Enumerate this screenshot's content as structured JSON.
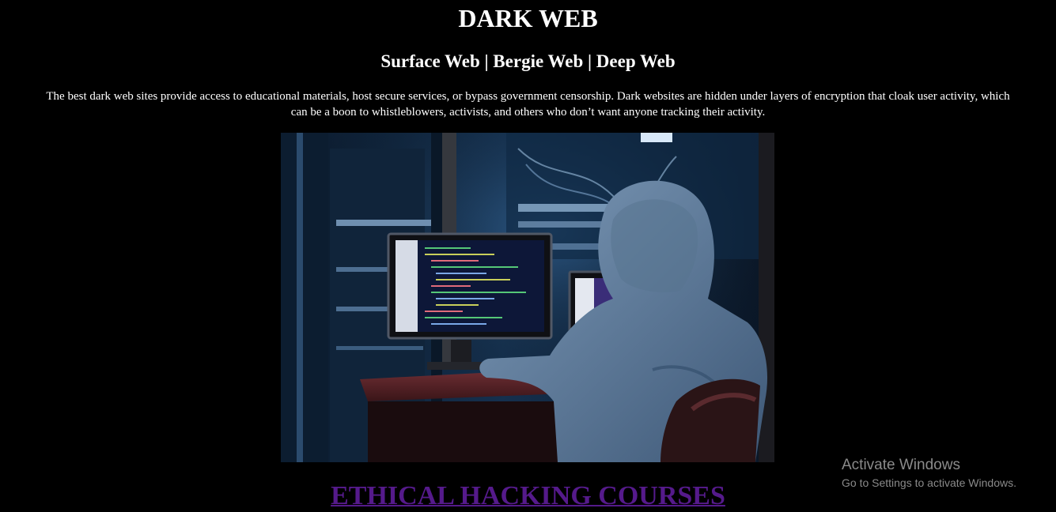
{
  "page": {
    "title": "DARK WEB",
    "subtitle": "Surface Web | Bergie Web | Deep Web",
    "description_line1": "The best dark web sites provide access to educational materials, host secure services, or bypass government censorship. Dark websites are hidden under layers of encryption that cloak user activity, which",
    "description_line2": "can be a boon to whistleblowers, activists, and others who don’t want anyone tracking their activity.",
    "cta_link": "ETHICAL HACKING COURSES",
    "link_color": "#551a8b",
    "background_color": "#000000"
  },
  "hero_image": {
    "subject": "hooded-hacker-at-computer"
  },
  "windows_watermark": {
    "title": "Activate Windows",
    "subtitle": "Go to Settings to activate Windows."
  }
}
